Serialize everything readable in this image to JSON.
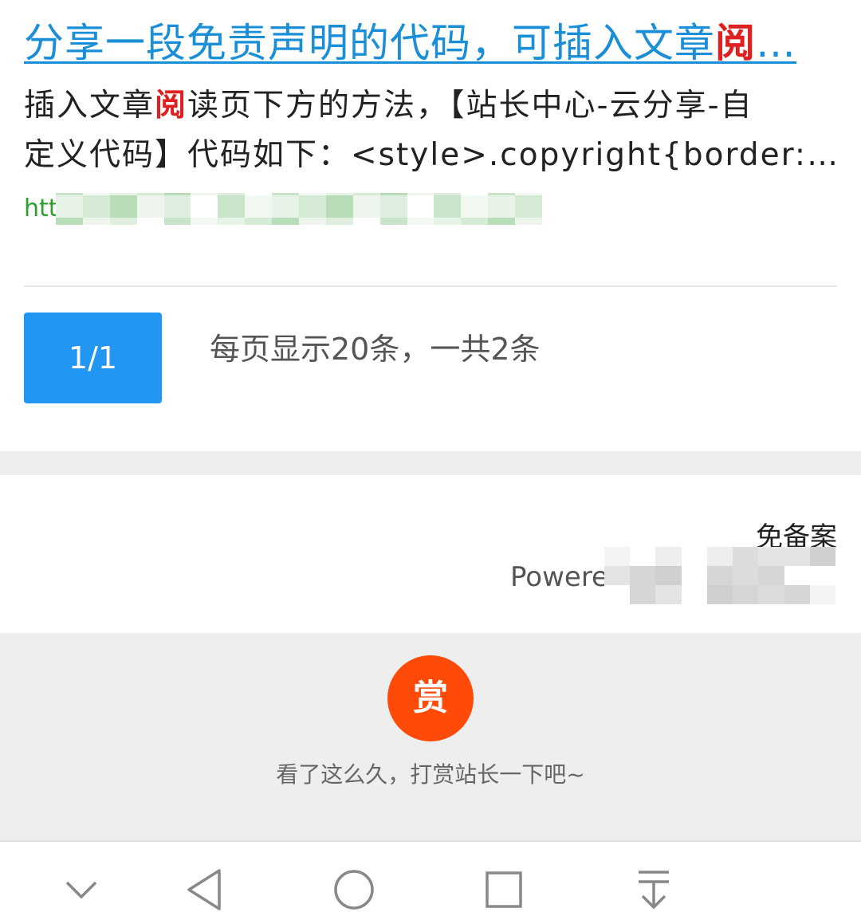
{
  "result": {
    "title_before": "分享一段免责声明的代码，可插入文章",
    "title_highlight": "阅",
    "title_ellipsis": "…",
    "snippet_line1_before": "插入文章",
    "snippet_highlight": "阅",
    "snippet_line1_after": "读页下方的方法，【站长中心-云分享-自",
    "snippet_line2": "定义代码】代码如下：<style>.copyright{border:…",
    "url": "http://www.lo00.cn/reade.html"
  },
  "pagination": {
    "current": "1/1",
    "info": "每页显示20条，一共2条"
  },
  "footer": {
    "icp": "免备案",
    "powered": "Powered by"
  },
  "reward": {
    "button_label": "赏",
    "prompt": "看了这么久，打赏站长一下吧~"
  },
  "nav": {
    "icons": [
      "chevron-down-icon",
      "back-triangle-icon",
      "home-circle-icon",
      "recents-square-icon",
      "download-icon"
    ]
  },
  "colors": {
    "link": "#1a8fd8",
    "highlight": "#e02020",
    "url": "#2e9e2e",
    "pager": "#2196f3",
    "reward": "#ff4a0a"
  }
}
